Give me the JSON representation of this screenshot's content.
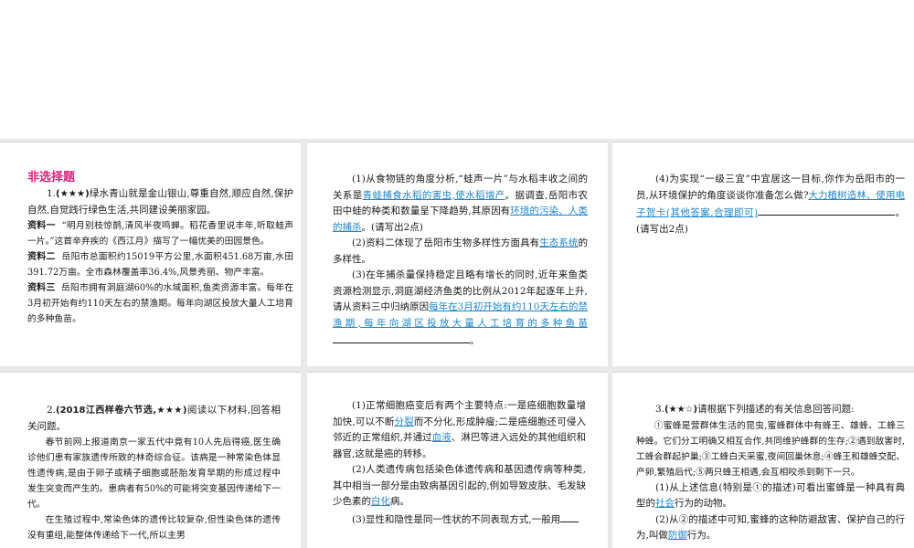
{
  "slide1": {
    "heading": "非选择题",
    "q1_num": "1.",
    "q1_stars": "(★★★)",
    "q1_text": "绿水青山就是金山银山,尊重自然,顺应自然,保护自然,自觉践行绿色生活,共同建设美丽家园。",
    "m1_label": "资料一",
    "m1_text": "“明月别枝惊鹊,清风半夜鸣蝉。稻花香里说丰年,听取蛙声一片。”这首辛弃疾的《西江月》描写了一幅优美的田园景色。",
    "m2_label": "资料二",
    "m2_text": "岳阳市总面积约15019平方公里,水面积451.68万亩,水田391.72万亩。全市森林覆盖率36.4%,风景秀丽、物产丰富。",
    "m3_label": "资料三",
    "m3_text": "岳阳市拥有洞庭湖60%的水域面积,鱼类资源丰富。每年在3月初开始有约110天左右的禁渔期。每年向湖区投放大量人工培育的多种鱼苗。"
  },
  "slide2": {
    "p1_a": "(1)从食物链的角度分析,“蛙声一片”与水稻丰收之间的关系是",
    "p1_ans": "青蛙捕食水稻的害虫,使水稻增产",
    "p1_b": "。据调查,岳阳市农田中蛙的种类和数量呈下降趋势,其原因有",
    "p1_ans2": "环境的污染、人类的捕杀",
    "p1_c": "。(请写出2点)",
    "p2_a": "(2)资料二体现了岳阳市生物多样性方面具有",
    "p2_ans": "生态系统",
    "p2_b": "的多样性。",
    "p3_a": "(3)在年捕杀量保持稳定且略有增长的同时,近年来鱼类资源检测显示,洞庭湖经济鱼类的比例从2012年起逐年上升,请从资料三中归纳原因",
    "p3_ans": "每年在3月初开始有约110天左右的禁渔期,每年向湖区投放大量人工培育的多种鱼苗",
    "p3_b": "。"
  },
  "slide3": {
    "p4_a": "(4)为实现“一级三宜”中宜居这一目标,你作为岳阳市的一员,从环境保护的角度谈谈你准备怎么做?",
    "p4_ans": "大力植树造林、使用电子贺卡(其他答案,合理即可)",
    "p4_b": "。(请写出2点)"
  },
  "slide4": {
    "q2_num": "2.",
    "q2_src": "(2018江西样卷六节选,★★★)",
    "q2_text": "阅读以下材料,回答相关问题。",
    "para1": "春节前网上报道南京一家五代中竟有10人先后得癌,医生确诊他们患有家族遗传所致的林奇综合征。该病是一种常染色体显性遗传病,是由于卵子或精子细胞或胚胎发育早期的形成过程中发生突变而产生的。患病者有50%的可能将突变基因传递给下一代。",
    "para2": "在生殖过程中,常染色体的遗传比较复杂,但性染色体的遗传没有重组,能整体传递给下一代,所以主男"
  },
  "slide5": {
    "p1_a": "(1)正常细胞癌变后有两个主要特点:一是癌细胞数量增加快,可以不断",
    "p1_ans": "分裂",
    "p1_b": "而不分化,形成肿瘤;二是癌细胞还可侵入邻近的正常组织,并通过",
    "p1_ans2": "血液",
    "p1_c": "、淋巴等进入远处的其他组织和器官,这就是癌的转移。",
    "p2_a": "(2)人类遗传病包括染色体遗传病和基因遗传病等种类,其中相当一部分是由致病基因引起的,例如导致皮肤、毛发缺少色素的",
    "p2_ans": "白化",
    "p2_b": "病。",
    "p3_a": "(3)显性和隐性是同一性状的不同表现方式,一般用"
  },
  "slide6": {
    "q3_num": "3.",
    "q3_stars": "(★★☆)",
    "q3_text": "请根据下列描述的有关信息回答问题:",
    "para": "①蜜蜂是营群体生活的昆虫,蜜蜂群体中有蜂王、雄蜂、工蜂三种蜂。它们分工明确又相互合作,共同维护蜂群的生存;②遇到敌害时,工蜂会群起护巢;③工蜂白天采蜜,夜间回巢休息;④蜂王和雄蜂交配、产卵,繁殖后代;⑤两只蜂王相遇,会互相咬杀到剩下一只。",
    "p1_a": "(1)从上述信息(特别是①的描述)可看出蜜蜂是一种具有典型的",
    "p1_ans": "社会",
    "p1_b": "行为的动物。",
    "p2_a": "(2)从②的描述中可知,蜜蜂的这种防避敌害、保护自己的行为,叫做",
    "p2_ans": "防御",
    "p2_b": "行为。"
  }
}
